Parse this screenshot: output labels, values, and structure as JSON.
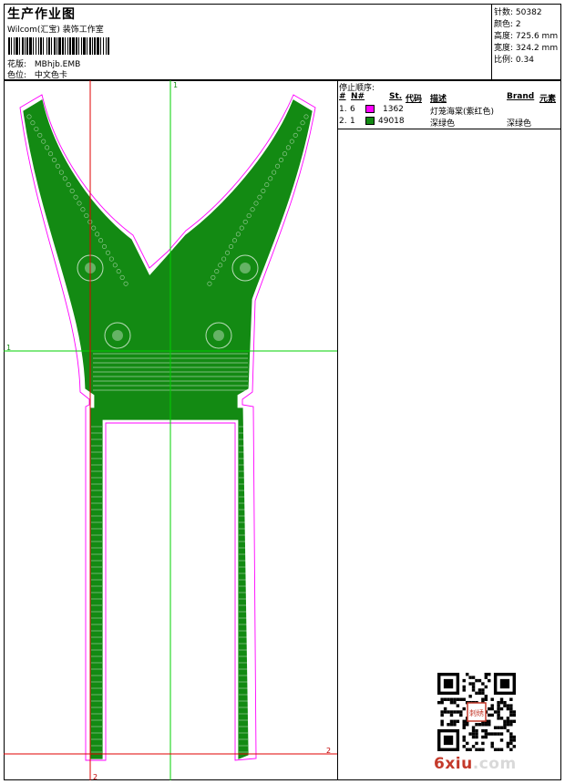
{
  "header": {
    "title": "生产作业图",
    "subtitle": "Wilcom(汇宝) 装饰工作室",
    "design_label": "花版:",
    "design_value": "MBhjb.EMB",
    "colorway_label": "色位:",
    "colorway_value": "中文色卡"
  },
  "stats": {
    "stitches_label": "针数:",
    "stitches_value": "50382",
    "colors_label": "颜色:",
    "colors_value": "2",
    "height_label": "高度:",
    "height_value": "725.6 mm",
    "width_label": "宽度:",
    "width_value": "324.2 mm",
    "scale_label": "比例:",
    "scale_value": "0.34"
  },
  "stop_sequence": {
    "title": "停止顺序:",
    "columns": {
      "num": "#",
      "n": "N#",
      "st": "St.",
      "code": "代码",
      "desc": "描述",
      "brand": "Brand",
      "elements": "元素"
    },
    "rows": [
      {
        "num": "1.",
        "n": "6",
        "color": "#ff00ff",
        "code": "1362",
        "desc": "灯笼海棠(紫红色)",
        "brand": ""
      },
      {
        "num": "2.",
        "n": "1",
        "color": "#138a13",
        "code": "49018",
        "desc": "深绿色",
        "brand": "深绿色"
      }
    ]
  },
  "guides": {
    "top_label": "1",
    "left_label": "1",
    "right_label": "2",
    "bottom_label": "2"
  },
  "colors": {
    "embroidery": "#138a13",
    "outline": "#ff00ff",
    "guide_green": "#00d000",
    "guide_red": "#e00000"
  },
  "watermark": {
    "part1": "6xiu",
    "part2": ".com",
    "seal": "刺绣"
  }
}
